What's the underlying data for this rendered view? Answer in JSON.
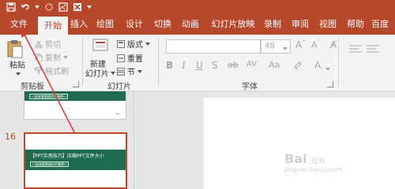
{
  "tabs": [
    "文件",
    "开始",
    "插入",
    "绘图",
    "设计",
    "切换",
    "动画",
    "幻灯片放映",
    "录制",
    "审阅",
    "视图",
    "帮助",
    "百度"
  ],
  "clipboard": {
    "paste": "粘贴",
    "cut": "剪切",
    "copy": "复制",
    "format_painter": "格式刷",
    "group_label": "剪贴板"
  },
  "slides": {
    "new_slide_line1": "新建",
    "new_slide_line2": "幻灯片",
    "layout": "版式",
    "reset": "重置",
    "section": "节",
    "group_label": "幻灯片"
  },
  "font": {
    "font_size": "48",
    "group_label": "字体"
  },
  "slide_pane": {
    "current_number": "16",
    "prev_thumb_pill": "一起来看看操作步骤吧~",
    "current_title": "【PPT实用技巧】压缩PPT文件大小",
    "current_pill": "一起来看看操作步骤吧~"
  },
  "watermark": {
    "brand": "Bai",
    "brand2": "经验",
    "url": "jingyan.baidu.com"
  },
  "colors": {
    "accent": "#b7472a",
    "slide_green": "#1f6b4f",
    "arrow": "#e03a2e"
  }
}
